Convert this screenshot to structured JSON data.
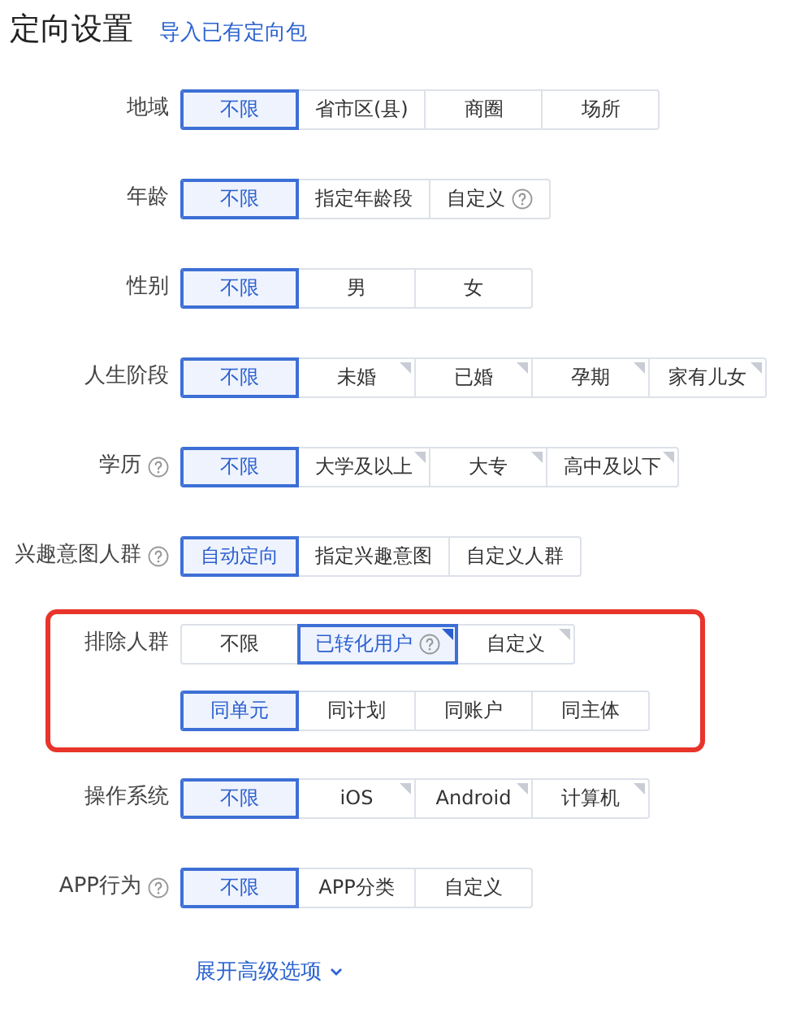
{
  "header": {
    "title": "定向设置",
    "link": "导入已有定向包"
  },
  "rows": [
    {
      "label": "地域",
      "help": false,
      "highlighted": false,
      "groups": [
        [
          {
            "text": "不限",
            "selected": true,
            "help": false,
            "corner": false
          },
          {
            "text": "省市区(县)",
            "selected": false,
            "help": false,
            "corner": false
          },
          {
            "text": "商圈",
            "selected": false,
            "help": false,
            "corner": false
          },
          {
            "text": "场所",
            "selected": false,
            "help": false,
            "corner": false
          }
        ]
      ]
    },
    {
      "label": "年龄",
      "help": false,
      "highlighted": false,
      "groups": [
        [
          {
            "text": "不限",
            "selected": true,
            "help": false,
            "corner": false
          },
          {
            "text": "指定年龄段",
            "selected": false,
            "help": false,
            "corner": false
          },
          {
            "text": "自定义",
            "selected": false,
            "help": true,
            "corner": false
          }
        ]
      ]
    },
    {
      "label": "性别",
      "help": false,
      "highlighted": false,
      "groups": [
        [
          {
            "text": "不限",
            "selected": true,
            "help": false,
            "corner": false
          },
          {
            "text": "男",
            "selected": false,
            "help": false,
            "corner": false
          },
          {
            "text": "女",
            "selected": false,
            "help": false,
            "corner": false
          }
        ]
      ]
    },
    {
      "label": "人生阶段",
      "help": false,
      "highlighted": false,
      "groups": [
        [
          {
            "text": "不限",
            "selected": true,
            "help": false,
            "corner": false
          },
          {
            "text": "未婚",
            "selected": false,
            "help": false,
            "corner": true
          },
          {
            "text": "已婚",
            "selected": false,
            "help": false,
            "corner": true
          },
          {
            "text": "孕期",
            "selected": false,
            "help": false,
            "corner": true
          },
          {
            "text": "家有儿女",
            "selected": false,
            "help": false,
            "corner": true
          }
        ]
      ]
    },
    {
      "label": "学历",
      "help": true,
      "highlighted": false,
      "groups": [
        [
          {
            "text": "不限",
            "selected": true,
            "help": false,
            "corner": false
          },
          {
            "text": "大学及以上",
            "selected": false,
            "help": false,
            "corner": true
          },
          {
            "text": "大专",
            "selected": false,
            "help": false,
            "corner": true
          },
          {
            "text": "高中及以下",
            "selected": false,
            "help": false,
            "corner": true
          }
        ]
      ]
    },
    {
      "label": "兴趣意图人群",
      "help": true,
      "highlighted": false,
      "groups": [
        [
          {
            "text": "自动定向",
            "selected": true,
            "help": false,
            "corner": false
          },
          {
            "text": "指定兴趣意图",
            "selected": false,
            "help": false,
            "corner": false
          },
          {
            "text": "自定义人群",
            "selected": false,
            "help": false,
            "corner": false
          }
        ]
      ]
    },
    {
      "label": "排除人群",
      "help": false,
      "highlighted": true,
      "groups": [
        [
          {
            "text": "不限",
            "selected": false,
            "help": false,
            "corner": false
          },
          {
            "text": "已转化用户",
            "selected": true,
            "help": true,
            "corner": true
          },
          {
            "text": "自定义",
            "selected": false,
            "help": false,
            "corner": true
          }
        ],
        [
          {
            "text": "同单元",
            "selected": true,
            "help": false,
            "corner": false
          },
          {
            "text": "同计划",
            "selected": false,
            "help": false,
            "corner": false
          },
          {
            "text": "同账户",
            "selected": false,
            "help": false,
            "corner": false
          },
          {
            "text": "同主体",
            "selected": false,
            "help": false,
            "corner": false
          }
        ]
      ]
    },
    {
      "label": "操作系统",
      "help": false,
      "highlighted": false,
      "groups": [
        [
          {
            "text": "不限",
            "selected": true,
            "help": false,
            "corner": false
          },
          {
            "text": "iOS",
            "selected": false,
            "help": false,
            "corner": true
          },
          {
            "text": "Android",
            "selected": false,
            "help": false,
            "corner": true
          },
          {
            "text": "计算机",
            "selected": false,
            "help": false,
            "corner": true
          }
        ]
      ]
    },
    {
      "label": "APP行为",
      "help": true,
      "highlighted": false,
      "groups": [
        [
          {
            "text": "不限",
            "selected": true,
            "help": false,
            "corner": false
          },
          {
            "text": "APP分类",
            "selected": false,
            "help": false,
            "corner": false
          },
          {
            "text": "自定义",
            "selected": false,
            "help": false,
            "corner": false
          }
        ]
      ]
    }
  ],
  "expand_link": "展开高级选项"
}
